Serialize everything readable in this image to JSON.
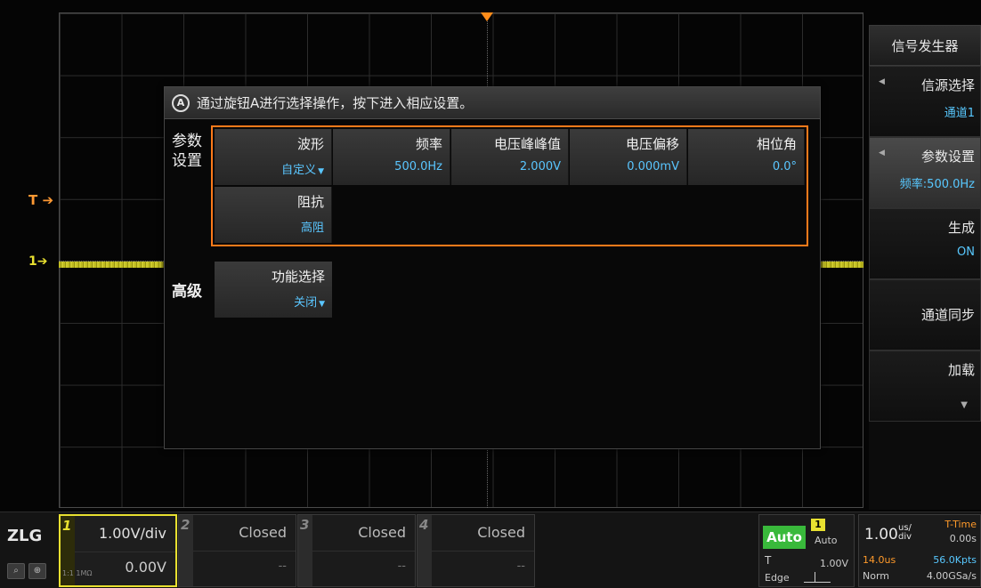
{
  "markers": {
    "trigger": "T",
    "ch1": "1"
  },
  "menu": {
    "title": "信号发生器",
    "items": [
      {
        "label": "信源选择",
        "value": "通道1"
      },
      {
        "label": "参数设置",
        "value": "频率:500.0Hz"
      },
      {
        "label": "生成",
        "value": "ON"
      },
      {
        "label": "通道同步",
        "value": ""
      },
      {
        "label": "加载",
        "value": ""
      }
    ]
  },
  "dialog": {
    "knob": "A",
    "hint": "通过旋钮A进行选择操作，按下进入相应设置。",
    "param_section": "参数设置",
    "adv_section": "高级",
    "params": [
      {
        "label": "波形",
        "value": "自定义"
      },
      {
        "label": "频率",
        "value": "500.0Hz"
      },
      {
        "label": "电压峰峰值",
        "value": "2.000V"
      },
      {
        "label": "电压偏移",
        "value": "0.000mV"
      },
      {
        "label": "相位角",
        "value": "0.0°"
      },
      {
        "label": "阻抗",
        "value": "高阻"
      }
    ],
    "advanced": {
      "label": "功能选择",
      "value": "关闭"
    }
  },
  "bottom": {
    "logo": "ZLG",
    "channels": [
      {
        "num": "1",
        "scale": "1.00V/div",
        "offset": "0.00V",
        "coupling": "1:1 1MΩ"
      },
      {
        "num": "2",
        "scale": "Closed",
        "offset": "--"
      },
      {
        "num": "3",
        "scale": "Closed",
        "offset": "--"
      },
      {
        "num": "4",
        "scale": "Closed",
        "offset": "--"
      }
    ],
    "trigger": {
      "mode_badge": "Auto",
      "source": "1",
      "mode": "Auto",
      "t": "T",
      "level": "1.00V",
      "type": "Edge"
    },
    "timebase": {
      "scale": "1.00",
      "unit_top": "us/",
      "unit_bottom": "div",
      "ref": "T-Time",
      "pos": "0.00s",
      "delay": "14.0us",
      "memory": "56.0Kpts",
      "acq_mode": "Norm",
      "sample_rate": "4.00GSa/s"
    }
  }
}
